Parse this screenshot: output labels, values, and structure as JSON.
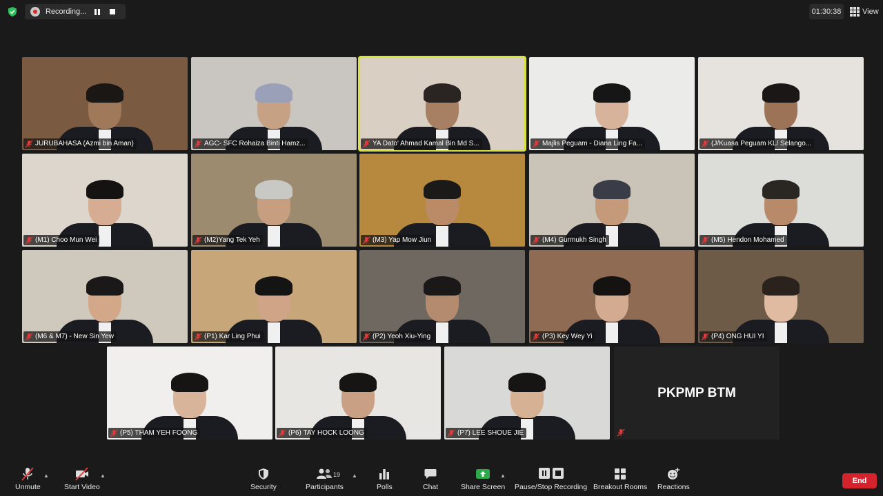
{
  "top_bar": {
    "recording_label": "Recording...",
    "timer": "01:30:38",
    "view_label": "View"
  },
  "tiles": [
    {
      "name": "JURUBAHASA (Azmi bin Aman)",
      "bg": "#7a5a40",
      "head": "#a0785a",
      "hair": "#1b1715"
    },
    {
      "name": "AGC- SFC Rohaiza Binti Hamz...",
      "bg": "#c9c6c2",
      "head": "#c7a183",
      "hair": "#9aa0b8"
    },
    {
      "name": "YA Dato' Ahmad Kamal Bin Md S...",
      "bg": "#d9cfc2",
      "head": "#a77f62",
      "hair": "#2a2523"
    },
    {
      "name": "Majlis Peguam - Diana Ling Fa...",
      "bg": "#ebebe9",
      "head": "#d6b39a",
      "hair": "#161616"
    },
    {
      "name": "(J/Kuasa Peguam KL/ Selango...",
      "bg": "#e6e3df",
      "head": "#9c7356",
      "hair": "#1a1716"
    },
    {
      "name": "(M1)  Choo Mun Wei",
      "bg": "#dcd6cc",
      "head": "#d6ad92",
      "hair": "#141312"
    },
    {
      "name": "(M2)Yang Tek Yeh",
      "bg": "#9d8b70",
      "head": "#c79f80",
      "hair": "#c8c8c4"
    },
    {
      "name": "(M3) Yap Mow Jiun",
      "bg": "#b6893e",
      "head": "#bb8a67",
      "hair": "#1c1a18"
    },
    {
      "name": "(M4) Gurmukh Singh",
      "bg": "#c9c3b8",
      "head": "#c59a7a",
      "hair": "#3a3d48"
    },
    {
      "name": "(M5) Hendon Mohamed",
      "bg": "#dcdcd8",
      "head": "#b88a6a",
      "hair": "#2a2622"
    },
    {
      "name": "(M6 & M7) - New Sin Yew",
      "bg": "#cfc8bc",
      "head": "#d3a888",
      "hair": "#1a1818"
    },
    {
      "name": "(P1) Kar Ling Phui",
      "bg": "#c7a679",
      "head": "#d0a587",
      "hair": "#151414"
    },
    {
      "name": "(P2) Yeoh Xiu-Ying",
      "bg": "#6f6861",
      "head": "#b58b70",
      "hair": "#1a1818"
    },
    {
      "name": "(P3) Key Wey Yi",
      "bg": "#8e6b52",
      "head": "#d3ab90",
      "hair": "#141312"
    },
    {
      "name": "(P4) ONG HUI YI",
      "bg": "#6e5b47",
      "head": "#e0bba1",
      "hair": "#2a221d"
    },
    {
      "name": "(P5) THAM YEH FOONG",
      "bg": "#f0efed",
      "head": "#d8b49a",
      "hair": "#161514"
    },
    {
      "name": "(P6) TAY HOCK LOONG",
      "bg": "#e8e6e3",
      "head": "#c9a083",
      "hair": "#161514"
    },
    {
      "name": "(P7) LEE SHOUE JIE",
      "bg": "#d9d9d7",
      "head": "#d7b194",
      "hair": "#161514"
    }
  ],
  "pk_tile": {
    "label": "PKPMP BTM"
  },
  "toolbar": {
    "unmute": "Unmute",
    "start_video": "Start Video",
    "security": "Security",
    "participants": "Participants",
    "participants_count": "19",
    "polls": "Polls",
    "chat": "Chat",
    "share_screen": "Share Screen",
    "pause_stop_recording": "Pause/Stop Recording",
    "breakout_rooms": "Breakout Rooms",
    "reactions": "Reactions",
    "end": "End"
  },
  "colors": {
    "share_green": "#2ea84a",
    "end_red": "#d4232d",
    "active_speaker": "#d8e23a",
    "muted_red": "#e03a3a"
  }
}
